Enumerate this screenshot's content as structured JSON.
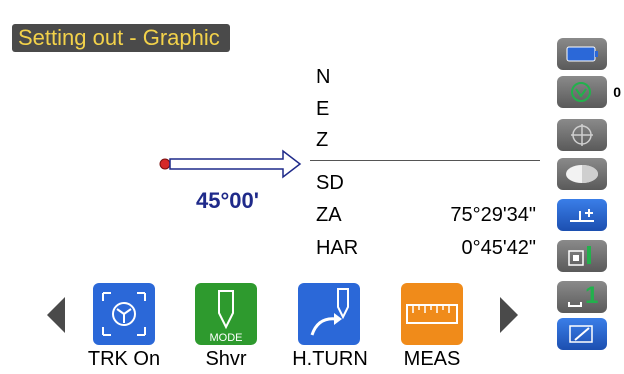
{
  "screen": {
    "title": "Setting out - Graphic"
  },
  "readout": {
    "rows": [
      {
        "label": "N",
        "value": ""
      },
      {
        "label": "E",
        "value": ""
      },
      {
        "label": "Z",
        "value": ""
      },
      {
        "label": "SD",
        "value": ""
      },
      {
        "label": "ZA",
        "value": "75°29'34\""
      },
      {
        "label": "HAR",
        "value": "0°45'42\""
      }
    ],
    "angle": "45°00'"
  },
  "side_panel": {
    "tracking_count": "0",
    "meas_mode_label": "1"
  },
  "softkeys": [
    {
      "label": "TRK On",
      "icon": "tracking-icon",
      "color": "#2b68d8"
    },
    {
      "label": "Shvr",
      "icon": "stake-mode-icon",
      "color": "#2e9a2e"
    },
    {
      "label": "H.TURN",
      "icon": "horizontal-turn-icon",
      "color": "#2b68d8"
    },
    {
      "label": "MEAS",
      "icon": "ruler-icon",
      "color": "#f08b1a"
    }
  ],
  "icons": {
    "battery": "battery-icon",
    "prism": "prism-icon",
    "crosshair": "crosshair-icon",
    "reflector": "reflector-icon",
    "target": "target-icon",
    "laser": "laser-icon",
    "mode": "mode-icon",
    "edit": "edit-icon",
    "left": "chevron-left-icon",
    "right": "chevron-right-icon"
  },
  "colors": {
    "title_bg": "#4a4a4a",
    "title_text": "#f3d24a",
    "arrow": "#1f2a8a",
    "angle_text": "#1f2a8a",
    "side_bg": "#6e6e6e",
    "side_highlight": "#2b68d8",
    "battery_fill": "#2b68d8",
    "green": "#22b14c",
    "orange": "#f08b1a"
  }
}
